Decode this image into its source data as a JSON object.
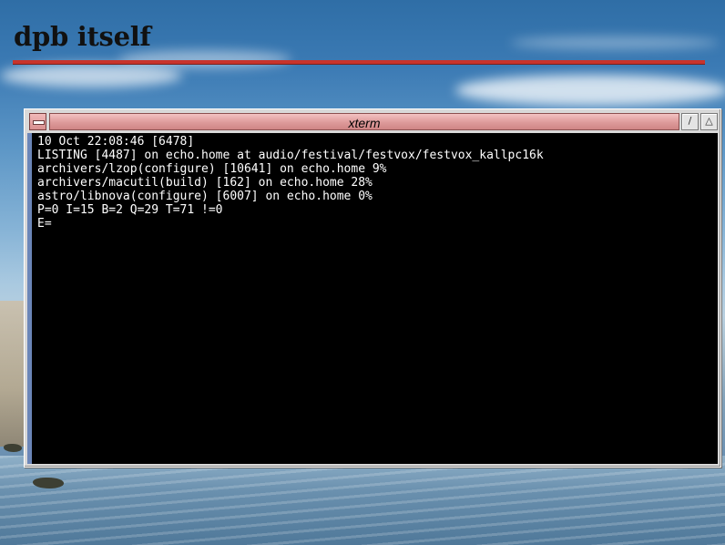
{
  "slide": {
    "title": "dpb itself"
  },
  "window": {
    "title": "xterm",
    "iconify_glyph": "/",
    "maximize_glyph": "△",
    "menu_icon": "window-menu-icon"
  },
  "terminal": {
    "lines": [
      "10 Oct 22:08:46 [6478]",
      "LISTING [4487] on echo.home at audio/festival/festvox/festvox_kallpc16k",
      "archivers/lzop(configure) [10641] on echo.home 9%",
      "archivers/macutil(build) [162] on echo.home 28%",
      "astro/libnova(configure) [6007] on echo.home 0%",
      "P=0 I=15 B=2 Q=29 T=71 !=0",
      "E="
    ]
  },
  "colors": {
    "title_rule": "#c8342c",
    "titlebar": "#dd9a9a",
    "terminal_bg": "#000000",
    "terminal_fg": "#ffffff"
  }
}
